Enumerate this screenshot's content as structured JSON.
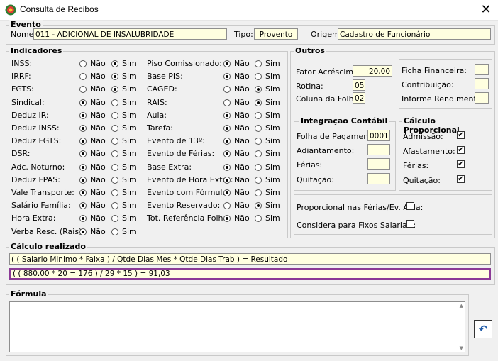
{
  "window": {
    "title": "Consulta de Recibos"
  },
  "evento": {
    "title": "Evento",
    "nome_label": "Nome:",
    "nome_value": "011 - ADICIONAL DE INSALUBRIDADE",
    "tipo_label": "Tipo:",
    "tipo_value": "Provento",
    "origem_label": "Origem:",
    "origem_value": "Cadastro de Funcionário"
  },
  "indicadores": {
    "title": "Indicadores",
    "nao": "Não",
    "sim": "Sim",
    "left": [
      {
        "label": "INSS:",
        "value": "Sim"
      },
      {
        "label": "IRRF:",
        "value": "Sim"
      },
      {
        "label": "FGTS:",
        "value": "Sim"
      },
      {
        "label": "Sindical:",
        "value": "Não"
      },
      {
        "label": "Deduz IR:",
        "value": "Não"
      },
      {
        "label": "Deduz INSS:",
        "value": "Não"
      },
      {
        "label": "Deduz FGTS:",
        "value": "Não"
      },
      {
        "label": "DSR:",
        "value": "Não"
      },
      {
        "label": "Adc. Noturno:",
        "value": "Não"
      },
      {
        "label": "Deduz FPAS:",
        "value": "Não"
      },
      {
        "label": "Vale Transporte:",
        "value": "Não"
      },
      {
        "label": "Salário Família:",
        "value": "Não"
      },
      {
        "label": "Hora Extra:",
        "value": "Não"
      },
      {
        "label": "Verba Resc. (Rais):",
        "value": "Não"
      }
    ],
    "right": [
      {
        "label": "Piso Comissionado:",
        "value": "Não"
      },
      {
        "label": "Base PIS:",
        "value": "Não"
      },
      {
        "label": "CAGED:",
        "value": "Sim"
      },
      {
        "label": "RAIS:",
        "value": "Sim"
      },
      {
        "label": "Aula:",
        "value": "Não"
      },
      {
        "label": "Tarefa:",
        "value": "Não"
      },
      {
        "label": "Evento de 13º:",
        "value": "Não"
      },
      {
        "label": "Evento de Férias:",
        "value": "Não"
      },
      {
        "label": "Base Extra:",
        "value": "Não"
      },
      {
        "label": "Evento de Hora Extra:",
        "value": "Não"
      },
      {
        "label": "Evento com Fórmula:",
        "value": "Não"
      },
      {
        "label": "Evento Reservado:",
        "value": "Sim"
      },
      {
        "label": "Tot. Referência Folha:",
        "value": "Não"
      }
    ]
  },
  "outros": {
    "title": "Outros",
    "fator_label": "Fator Acréscimo:",
    "fator_value": "20,00",
    "rotina_label": "Rotina:",
    "rotina_value": "05",
    "coluna_label": "Coluna da Folha:",
    "coluna_value": "02",
    "ficha_label": "Ficha Financeira:",
    "contrib_label": "Contribuição:",
    "informe_label": "Informe Rendimentos:"
  },
  "integracao": {
    "title": "Integração Contábil",
    "items": [
      {
        "label": "Folha de Pagamento:",
        "value": "0001"
      },
      {
        "label": "Adiantamento:",
        "value": ""
      },
      {
        "label": "Férias:",
        "value": ""
      },
      {
        "label": "Quitação:",
        "value": ""
      }
    ]
  },
  "proporcional": {
    "title": "Cálculo Proporcional",
    "items": [
      {
        "label": "Admissão:",
        "checked": "✔"
      },
      {
        "label": "Afastamento:",
        "checked": "✔"
      },
      {
        "label": "Férias:",
        "checked": "✔"
      },
      {
        "label": "Quitação:",
        "checked": "✔"
      }
    ]
  },
  "extras": {
    "ferias_aula_label": "Proporcional nas Férias/Ev. Aula:",
    "fixos_label": "Considera para Fixos Salariais:"
  },
  "calculo": {
    "title": "Cálculo realizado",
    "formula_text": "( ( Salario Minimo * Faixa ) / Qtde Dias Mes * Qtde Dias Trab )  = Resultado",
    "result_text": "( ( 880.00       * 20 = 176 ) / 29 * 15 ) = 91,03",
    "highlight_color": "#8b3a96"
  },
  "formula": {
    "title": "Fórmula",
    "content": ""
  },
  "icons": {
    "app": "app-logo-icon",
    "close": "close-icon",
    "undo": "undo-icon"
  }
}
